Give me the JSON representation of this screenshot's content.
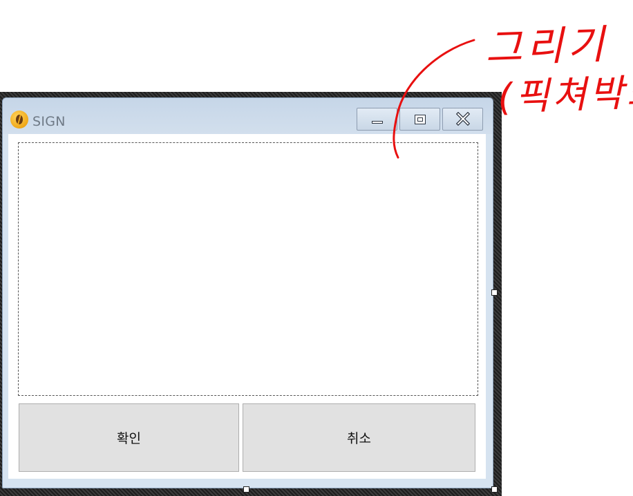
{
  "window": {
    "title": "SIGN",
    "caption_buttons": {
      "minimize": "minimize-icon",
      "maximize": "maximize-icon",
      "close": "close-icon"
    }
  },
  "picture_box": {
    "style": "dashed-border",
    "content": ""
  },
  "buttons": {
    "ok_label": "확인",
    "cancel_label": "취소"
  },
  "annotation": {
    "line1": "그리기",
    "line2": "(픽쳐박스)",
    "color": "#e81010"
  },
  "colors": {
    "title_text": "#6f7a86",
    "titlebar": "#c6d6e8",
    "button_face": "#e1e1e1"
  }
}
